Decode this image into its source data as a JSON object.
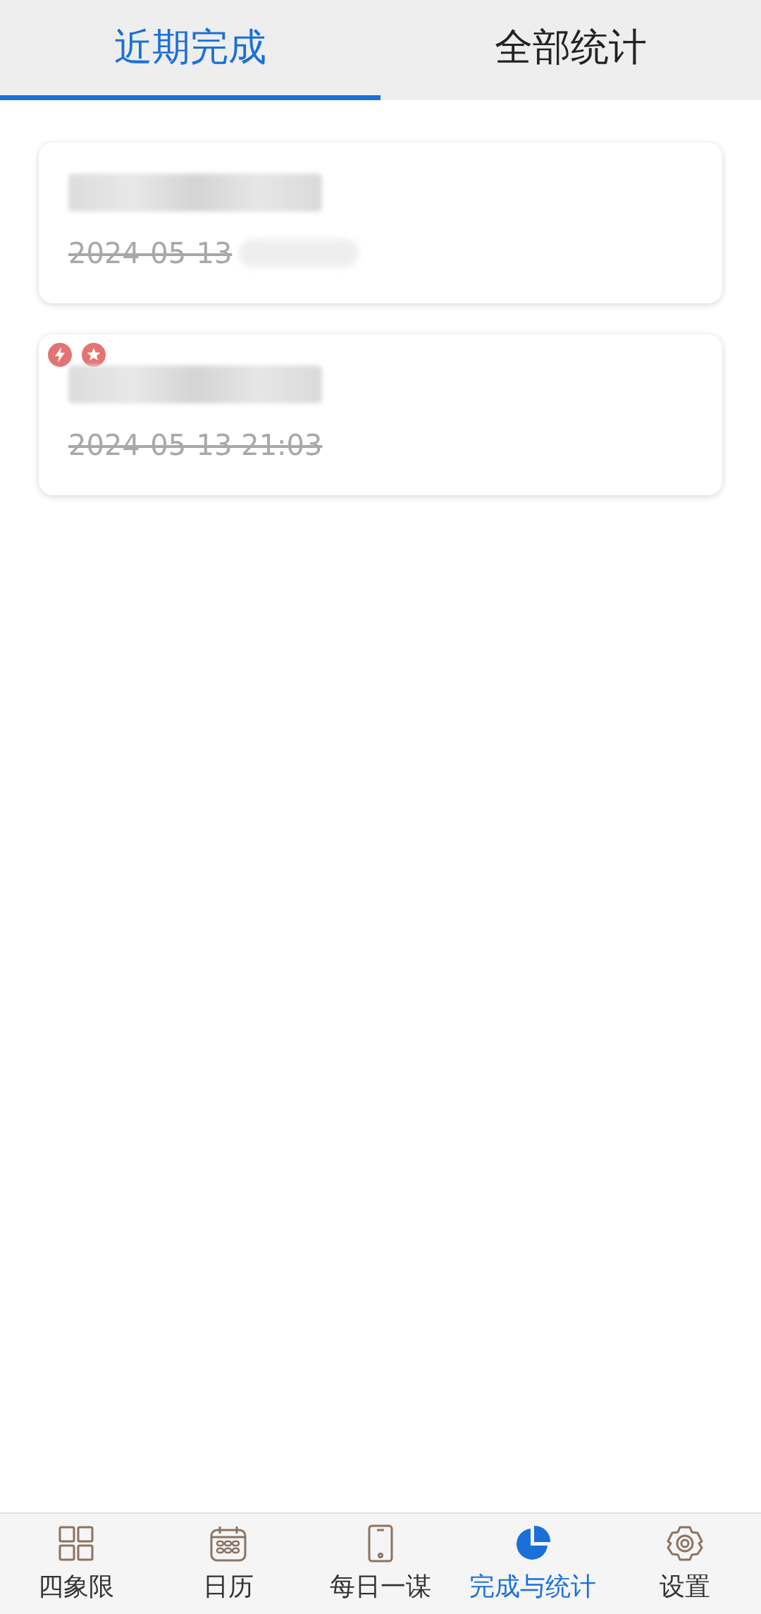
{
  "tabs": [
    {
      "label": "近期完成",
      "selected": true
    },
    {
      "label": "全部统计",
      "selected": false
    }
  ],
  "tasks": [
    {
      "date": "2024-05-13",
      "completed": true
    },
    {
      "date": "2024-05-13 21:03",
      "completed": true,
      "badges": [
        {
          "kind": "urgent"
        },
        {
          "kind": "important"
        }
      ]
    }
  ],
  "nav": [
    {
      "label": "四象限",
      "kind": "quadrants",
      "selected": false
    },
    {
      "label": "日历",
      "kind": "calendar",
      "selected": false
    },
    {
      "label": "每日一谋",
      "kind": "phone",
      "selected": false
    },
    {
      "label": "完成与统计",
      "kind": "stats",
      "selected": true
    },
    {
      "label": "设置",
      "kind": "settings",
      "selected": false
    }
  ]
}
